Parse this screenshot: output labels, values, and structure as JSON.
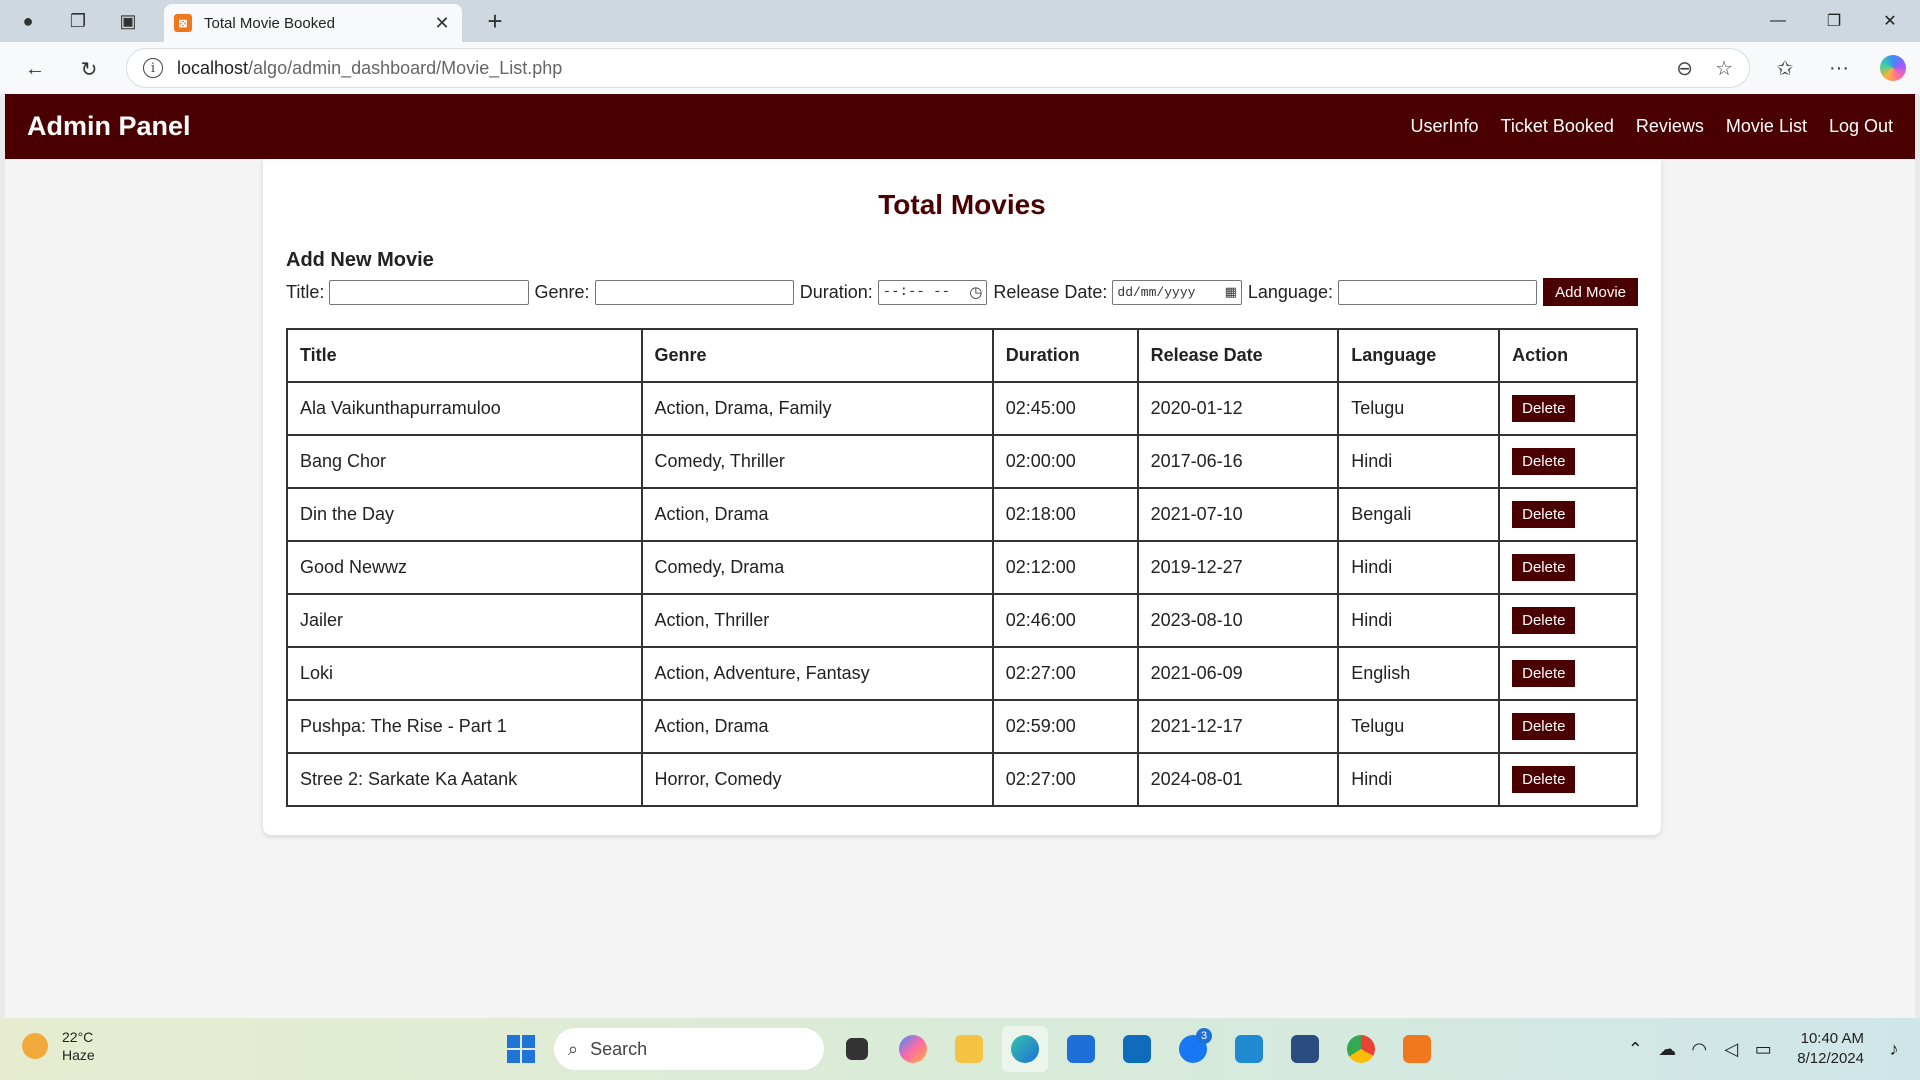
{
  "browser": {
    "tab_title": "Total Movie Booked",
    "url_host": "localhost",
    "url_path": "/algo/admin_dashboard/Movie_List.php"
  },
  "navbar": {
    "brand": "Admin Panel",
    "links": [
      "UserInfo",
      "Ticket Booked",
      "Reviews",
      "Movie List",
      "Log Out"
    ]
  },
  "main": {
    "title": "Total Movies",
    "form_heading": "Add New Movie",
    "labels": {
      "title": "Title:",
      "genre": "Genre:",
      "duration": "Duration:",
      "release_date": "Release Date:",
      "language": "Language:"
    },
    "duration_placeholder": "--:-- --",
    "date_placeholder": "dd/mm/yyyy",
    "add_button": "Add Movie",
    "table": {
      "headers": [
        "Title",
        "Genre",
        "Duration",
        "Release Date",
        "Language",
        "Action"
      ],
      "rows": [
        [
          "Ala Vaikunthapurramuloo",
          "Action, Drama, Family",
          "02:45:00",
          "2020-01-12",
          "Telugu",
          "Delete"
        ],
        [
          "Bang Chor",
          "Comedy, Thriller",
          "02:00:00",
          "2017-06-16",
          "Hindi",
          "Delete"
        ],
        [
          "Din the Day",
          "Action, Drama",
          "02:18:00",
          "2021-07-10",
          "Bengali",
          "Delete"
        ],
        [
          "Good Newwz",
          "Comedy, Drama",
          "02:12:00",
          "2019-12-27",
          "Hindi",
          "Delete"
        ],
        [
          "Jailer",
          "Action, Thriller",
          "02:46:00",
          "2023-08-10",
          "Hindi",
          "Delete"
        ],
        [
          "Loki",
          "Action, Adventure, Fantasy",
          "02:27:00",
          "2021-06-09",
          "English",
          "Delete"
        ],
        [
          "Pushpa: The Rise - Part 1",
          "Action, Drama",
          "02:59:00",
          "2021-12-17",
          "Telugu",
          "Delete"
        ],
        [
          "Stree 2: Sarkate Ka Aatank",
          "Horror, Comedy",
          "02:27:00",
          "2024-08-01",
          "Hindi",
          "Delete"
        ]
      ]
    }
  },
  "taskbar": {
    "temperature": "22°C",
    "weather": "Haze",
    "search_placeholder": "Search",
    "time": "10:40 AM",
    "date": "8/12/2024",
    "badge": "3"
  },
  "colors": {
    "brand": "#4a0000"
  }
}
